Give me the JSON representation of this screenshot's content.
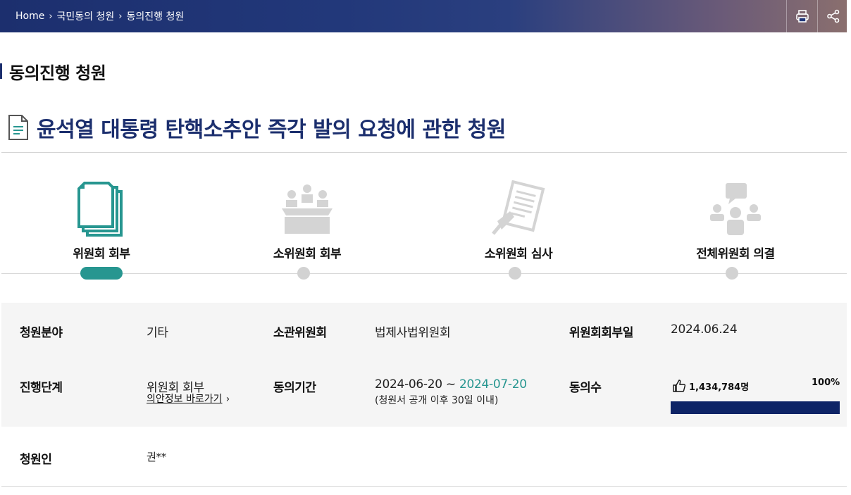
{
  "breadcrumb": {
    "home": "Home",
    "level1": "국민동의 청원",
    "level2": "동의진행 청원"
  },
  "page_title": "동의진행 청원",
  "petition_title": "윤석열 대통령 탄핵소추안 즉각 발의 요청에 관한 청원",
  "steps": [
    {
      "label": "위원회 회부",
      "active": true
    },
    {
      "label": "소위원회 회부",
      "active": false
    },
    {
      "label": "소위원회 심사",
      "active": false
    },
    {
      "label": "전체위원회 의결",
      "active": false
    }
  ],
  "info": {
    "field_label": "청원분야",
    "field_value": "기타",
    "committee_label": "소관위원회",
    "committee_value": "법제사법위원회",
    "referral_label": "위원회회부일",
    "referral_value": "2024.06.24",
    "stage_label": "진행단계",
    "stage_value": "위원회 회부",
    "stage_link": "의안정보 바로가기",
    "period_label": "동의기간",
    "period_start": "2024-06-20 ~ ",
    "period_end": "2024-07-20",
    "period_note": "(청원서 공개 이후 30일 이내)",
    "count_label": "동의수",
    "count_value": "1,434,784명",
    "count_percent": "100%",
    "progress_fraction": 1.0,
    "petitioner_label": "청원인",
    "petitioner_value": "권**"
  },
  "colors": {
    "accent_navy": "#1c2f6e",
    "accent_teal": "#279690",
    "progress_fill": "#0e2466"
  }
}
